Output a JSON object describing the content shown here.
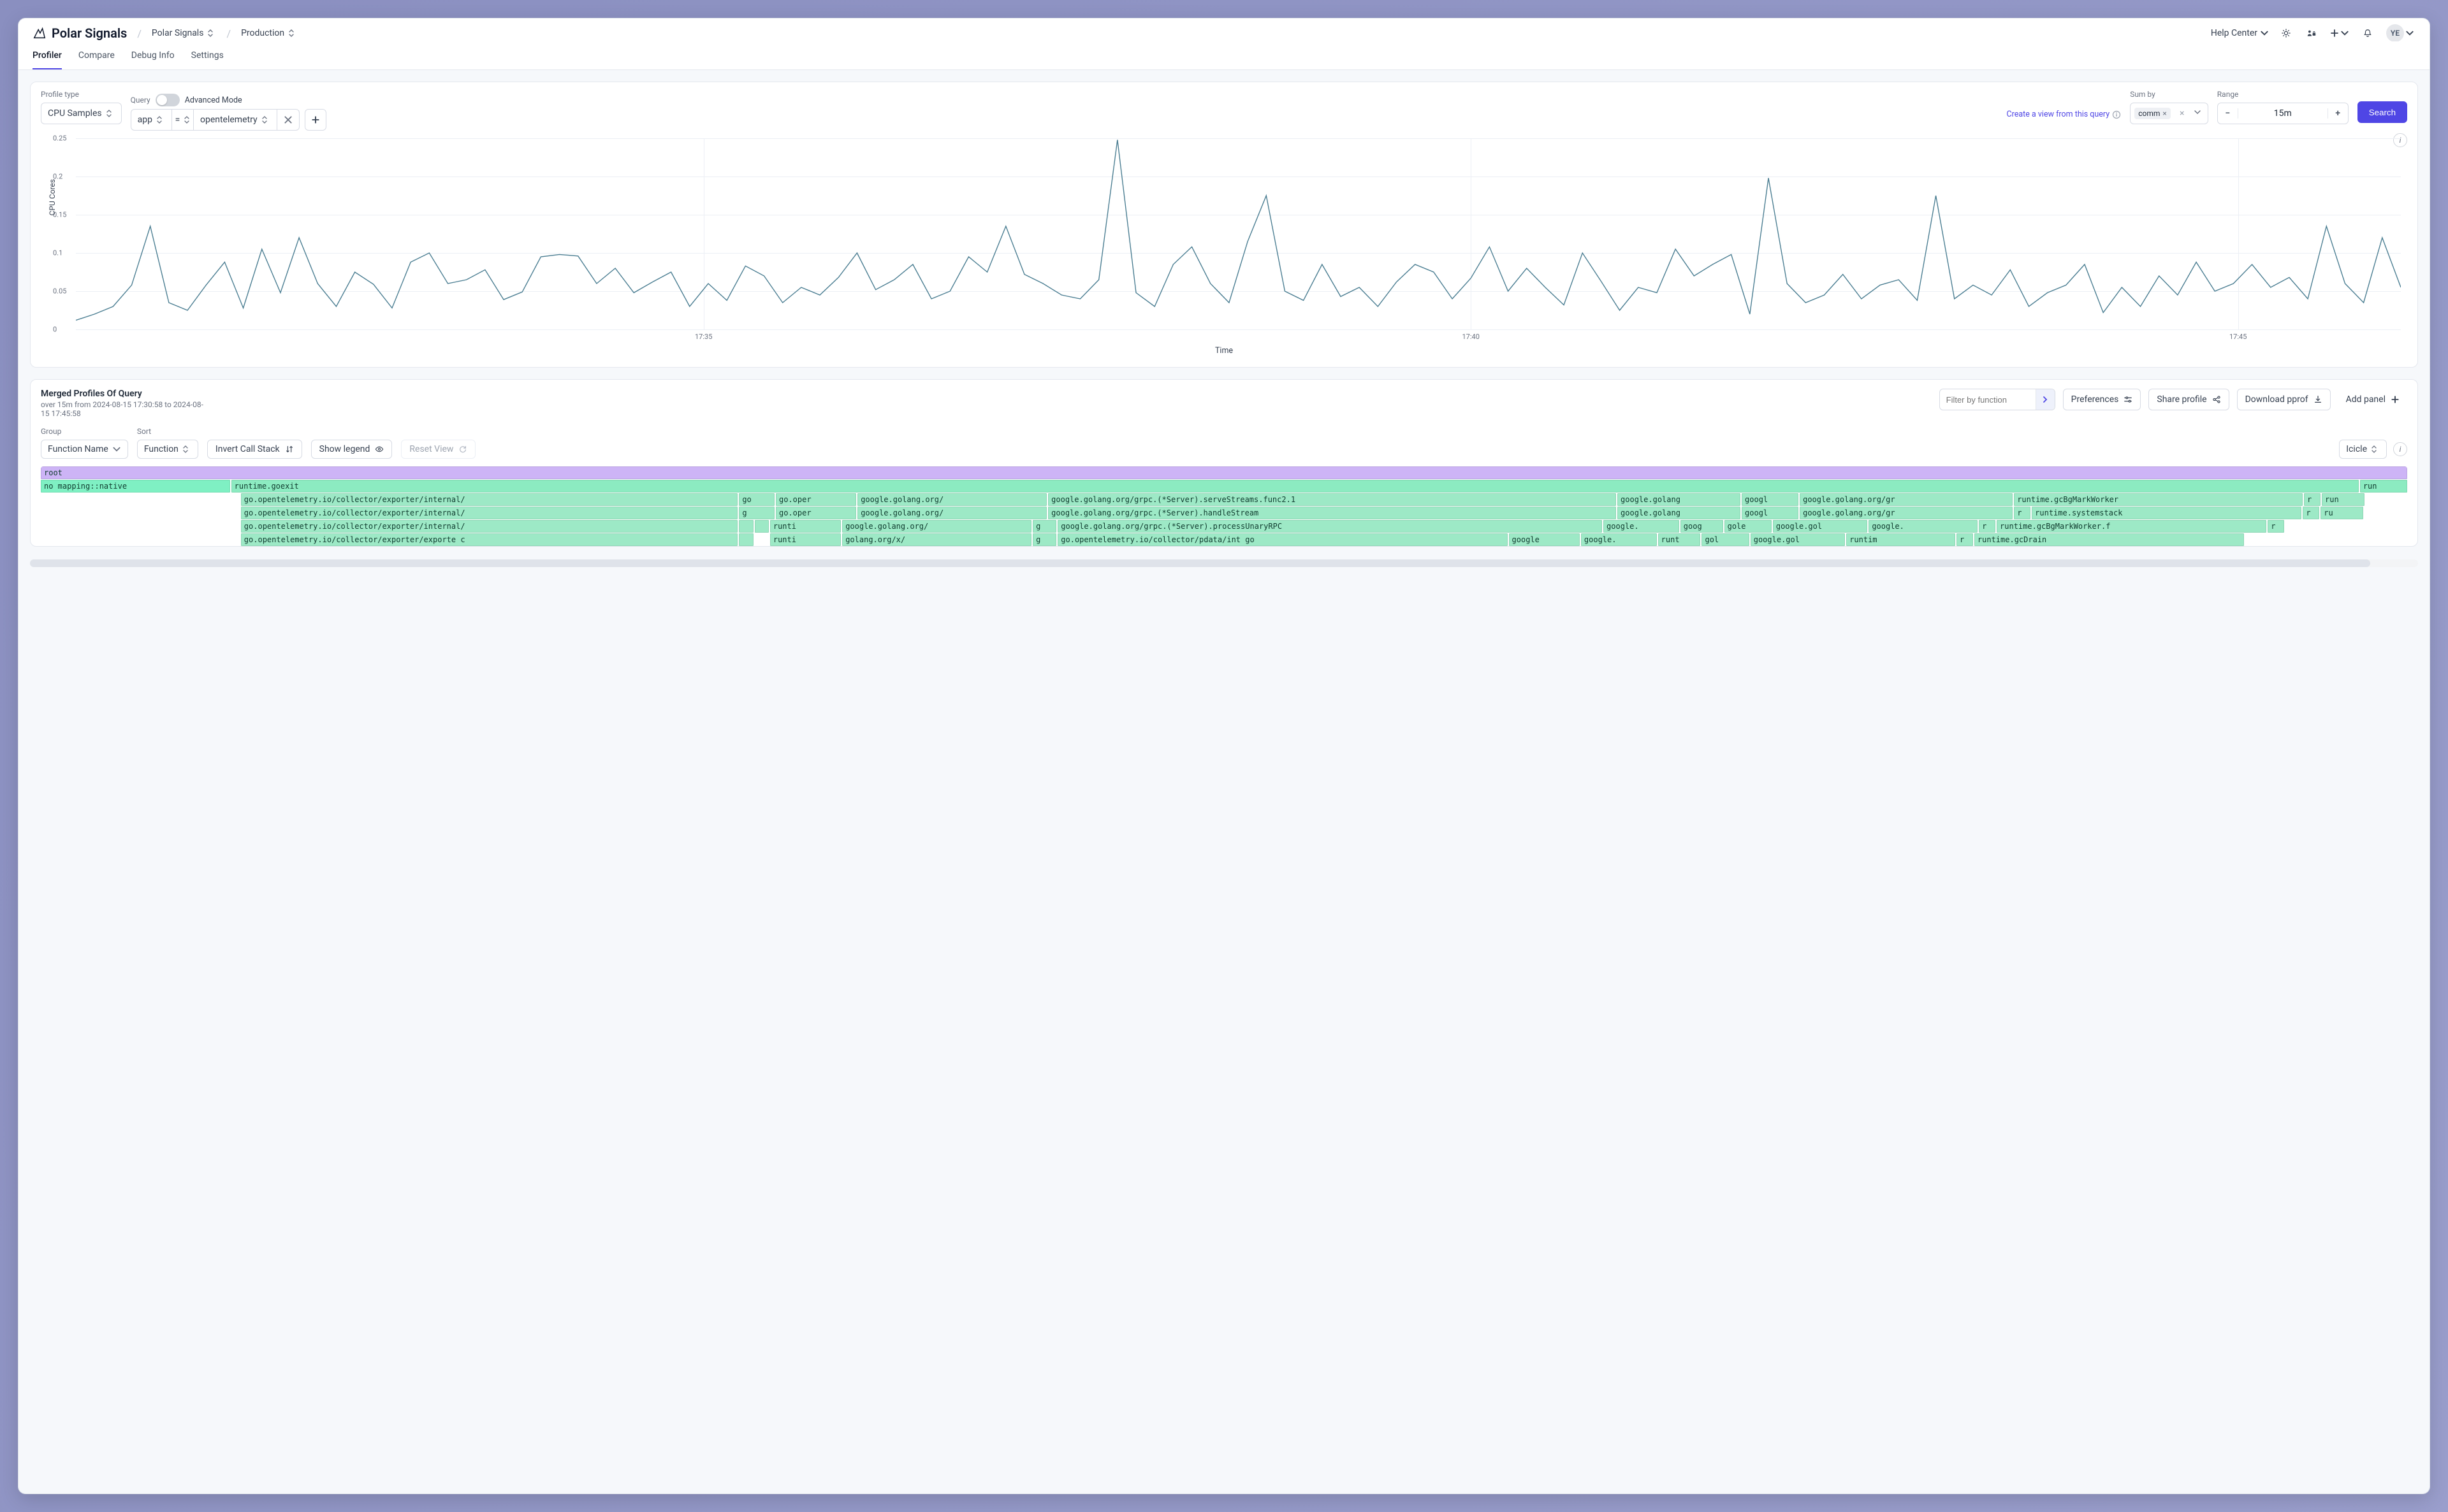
{
  "brand": {
    "name": "Polar Signals"
  },
  "breadcrumbs": {
    "org": "Polar Signals",
    "project": "Production"
  },
  "header": {
    "help_label": "Help Center",
    "avatar_initials": "YE"
  },
  "nav": {
    "tabs": [
      "Profiler",
      "Compare",
      "Debug Info",
      "Settings"
    ],
    "active_index": 0
  },
  "query_bar": {
    "profile_type_label": "Profile type",
    "profile_type_value": "CPU Samples",
    "query_label": "Query",
    "advanced_mode_label": "Advanced Mode",
    "advanced_mode_on": false,
    "filter_key": "app",
    "filter_op": "=",
    "filter_value": "opentelemetry",
    "create_view_link": "Create a view from this query",
    "sumby_label": "Sum by",
    "sumby_chip": "comm",
    "range_label": "Range",
    "range_value": "15m",
    "search_label": "Search"
  },
  "chart_data": {
    "type": "line",
    "title": "",
    "xlabel": "Time",
    "ylabel": "CPU Cores",
    "ylim": [
      0,
      0.25
    ],
    "y_ticks": [
      0,
      0.05,
      0.1,
      0.15,
      0.2,
      0.25
    ],
    "x_ticks": [
      "17:35",
      "17:40",
      "17:45"
    ],
    "x_tick_positions": [
      0.27,
      0.6,
      0.93
    ],
    "series": [
      {
        "name": "comm",
        "color": "#4b7e92",
        "values": [
          0.012,
          0.02,
          0.03,
          0.058,
          0.135,
          0.035,
          0.025,
          0.058,
          0.088,
          0.028,
          0.105,
          0.048,
          0.12,
          0.06,
          0.03,
          0.075,
          0.059,
          0.028,
          0.088,
          0.1,
          0.06,
          0.065,
          0.078,
          0.039,
          0.049,
          0.095,
          0.098,
          0.096,
          0.06,
          0.08,
          0.048,
          0.062,
          0.075,
          0.03,
          0.06,
          0.038,
          0.083,
          0.07,
          0.035,
          0.055,
          0.045,
          0.068,
          0.1,
          0.052,
          0.065,
          0.085,
          0.04,
          0.05,
          0.095,
          0.075,
          0.135,
          0.072,
          0.06,
          0.045,
          0.04,
          0.065,
          0.248,
          0.048,
          0.03,
          0.085,
          0.108,
          0.06,
          0.035,
          0.115,
          0.175,
          0.05,
          0.038,
          0.085,
          0.043,
          0.055,
          0.03,
          0.062,
          0.085,
          0.075,
          0.04,
          0.067,
          0.108,
          0.05,
          0.08,
          0.055,
          0.032,
          0.1,
          0.063,
          0.025,
          0.055,
          0.048,
          0.105,
          0.07,
          0.085,
          0.098,
          0.02,
          0.198,
          0.06,
          0.035,
          0.045,
          0.072,
          0.04,
          0.058,
          0.065,
          0.038,
          0.175,
          0.04,
          0.058,
          0.045,
          0.078,
          0.03,
          0.048,
          0.058,
          0.085,
          0.022,
          0.055,
          0.03,
          0.07,
          0.045,
          0.088,
          0.05,
          0.06,
          0.085,
          0.055,
          0.068,
          0.04,
          0.135,
          0.06,
          0.035,
          0.12,
          0.055
        ]
      }
    ]
  },
  "profiles_panel": {
    "title": "Merged Profiles Of Query",
    "subtitle": "over 15m from 2024-08-15 17:30:58 to 2024-08-15 17:45:58",
    "filter_placeholder": "Filter by function",
    "preferences_label": "Preferences",
    "share_label": "Share profile",
    "download_label": "Download pprof",
    "add_panel_label": "Add panel",
    "group_label": "Group",
    "group_value": "Function Name",
    "sort_label": "Sort",
    "sort_value": "Function",
    "invert_label": "Invert Call Stack",
    "legend_label": "Show legend",
    "reset_label": "Reset View",
    "view_mode": "Icicle"
  },
  "flame": {
    "rows": [
      [
        {
          "text": "root",
          "cls": "c-root",
          "w": 100
        }
      ],
      [
        {
          "text": "no mapping::native",
          "cls": "c-native",
          "w": 8
        },
        {
          "text": "runtime.goexit",
          "cls": "c-go",
          "w": 90
        },
        {
          "text": "run",
          "cls": "c-go",
          "w": 2
        }
      ],
      [
        {
          "text": "",
          "cls": "",
          "w": 8.4
        },
        {
          "text": "go.opentelemetry.io/collector/exporter/internal/",
          "cls": "c-go2",
          "w": 21
        },
        {
          "text": "go",
          "cls": "c-go2",
          "w": 1.5
        },
        {
          "text": "go.oper",
          "cls": "c-go2",
          "w": 3.4
        },
        {
          "text": "google.golang.org/",
          "cls": "c-go2",
          "w": 8
        },
        {
          "text": "google.golang.org/grpc.(*Server).serveStreams.func2.1",
          "cls": "c-go2",
          "w": 24
        },
        {
          "text": "google.golang",
          "cls": "c-go2",
          "w": 5.2
        },
        {
          "text": "googl",
          "cls": "c-go2",
          "w": 2.4
        },
        {
          "text": "google.golang.org/gr",
          "cls": "c-go2",
          "w": 9
        },
        {
          "text": "runtime.gcBgMarkWorker",
          "cls": "c-go2",
          "w": 12.2
        },
        {
          "text": "r",
          "cls": "c-go2",
          "w": 0.7
        },
        {
          "text": "run",
          "cls": "c-go2",
          "w": 1.8
        }
      ],
      [
        {
          "text": "",
          "cls": "",
          "w": 8.4
        },
        {
          "text": "go.opentelemetry.io/collector/exporter/internal/",
          "cls": "c-go2",
          "w": 21
        },
        {
          "text": "g",
          "cls": "c-go2",
          "w": 1.5
        },
        {
          "text": "go.oper",
          "cls": "c-go2",
          "w": 3.4
        },
        {
          "text": "google.golang.org/",
          "cls": "c-go2",
          "w": 8
        },
        {
          "text": "google.golang.org/grpc.(*Server).handleStream",
          "cls": "c-go2",
          "w": 24
        },
        {
          "text": "google.golang",
          "cls": "c-go2",
          "w": 5.2
        },
        {
          "text": "googl",
          "cls": "c-go2",
          "w": 2.4
        },
        {
          "text": "google.golang.org/gr",
          "cls": "c-go2",
          "w": 9
        },
        {
          "text": "r",
          "cls": "c-go2",
          "w": 0.7
        },
        {
          "text": "runtime.systemstack",
          "cls": "c-go2",
          "w": 11.4
        },
        {
          "text": "r",
          "cls": "c-go2",
          "w": 0.7
        },
        {
          "text": "ru",
          "cls": "c-go2",
          "w": 1.8
        }
      ],
      [
        {
          "text": "",
          "cls": "",
          "w": 8.4
        },
        {
          "text": "go.opentelemetry.io/collector/exporter/internal/",
          "cls": "c-go2",
          "w": 21
        },
        {
          "text": "",
          "cls": "c-go2",
          "w": 0.6
        },
        {
          "text": "",
          "cls": "c-go2",
          "w": 0.6
        },
        {
          "text": "runti",
          "cls": "c-go2",
          "w": 3
        },
        {
          "text": "google.golang.org/",
          "cls": "c-go2",
          "w": 8
        },
        {
          "text": "g",
          "cls": "c-go2",
          "w": 1
        },
        {
          "text": "google.golang.org/grpc.(*Server).processUnaryRPC",
          "cls": "c-go2",
          "w": 23
        },
        {
          "text": "google.",
          "cls": "c-go2",
          "w": 3.2
        },
        {
          "text": "goog",
          "cls": "c-go2",
          "w": 1.8
        },
        {
          "text": "gole",
          "cls": "c-go2",
          "w": 2
        },
        {
          "text": "google.gol",
          "cls": "c-go2",
          "w": 4
        },
        {
          "text": "google.",
          "cls": "c-go2",
          "w": 4.6
        },
        {
          "text": "r",
          "cls": "c-go2",
          "w": 0.7
        },
        {
          "text": "runtime.gcBgMarkWorker.f",
          "cls": "c-go2",
          "w": 11.4
        },
        {
          "text": "r",
          "cls": "c-go2",
          "w": 0.7
        },
        {
          "text": "",
          "cls": "",
          "w": 1.8
        }
      ],
      [
        {
          "text": "",
          "cls": "",
          "w": 8.4
        },
        {
          "text": "go.opentelemetry.io/collector/exporter/exporte c",
          "cls": "c-go2",
          "w": 21
        },
        {
          "text": "",
          "cls": "c-go2",
          "w": 0.6
        },
        {
          "text": "",
          "cls": "",
          "w": 0.6
        },
        {
          "text": "runti",
          "cls": "c-go2",
          "w": 3
        },
        {
          "text": "golang.org/x/",
          "cls": "c-go2",
          "w": 8
        },
        {
          "text": "g",
          "cls": "c-go2",
          "w": 1
        },
        {
          "text": "go.opentelemetry.io/collector/pdata/int  go",
          "cls": "c-go2",
          "w": 19
        },
        {
          "text": "google",
          "cls": "c-go2",
          "w": 3
        },
        {
          "text": "google.",
          "cls": "c-go2",
          "w": 3.2
        },
        {
          "text": "runt",
          "cls": "c-go2",
          "w": 1.8
        },
        {
          "text": "gol",
          "cls": "c-go2",
          "w": 2
        },
        {
          "text": "google.gol",
          "cls": "c-go2",
          "w": 4
        },
        {
          "text": "runtim",
          "cls": "c-go2",
          "w": 4.6
        },
        {
          "text": "r",
          "cls": "c-go2",
          "w": 0.7
        },
        {
          "text": "runtime.gcDrain",
          "cls": "c-go2",
          "w": 11.4
        },
        {
          "text": "",
          "cls": "",
          "w": 2.5
        }
      ]
    ]
  }
}
